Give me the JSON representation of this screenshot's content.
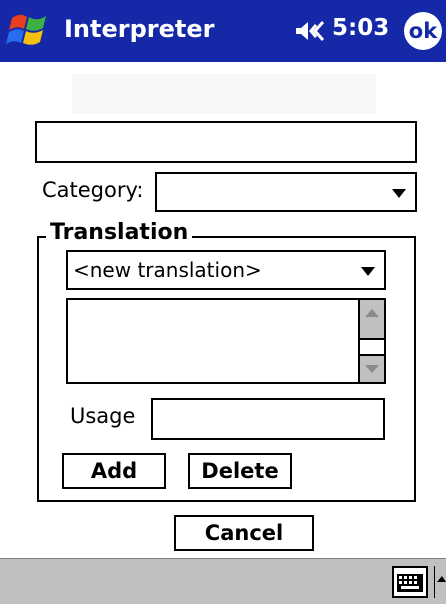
{
  "titlebar": {
    "app_title": "Interpreter",
    "clock": "5:03",
    "ok_label": "ok",
    "color": "#1428a8"
  },
  "form": {
    "name_value": "",
    "category_label": "Category:",
    "category_value": "",
    "translation_legend": "Translation",
    "translation_select_value": "<new translation>",
    "translation_text": "",
    "usage_label": "Usage",
    "usage_value": "",
    "add_label": "Add",
    "delete_label": "Delete",
    "cancel_label": "Cancel"
  },
  "icons": {
    "start": "windows-start-icon",
    "speaker": "speaker-icon",
    "keyboard": "keyboard-icon",
    "sip": "chevron-up-icon"
  }
}
